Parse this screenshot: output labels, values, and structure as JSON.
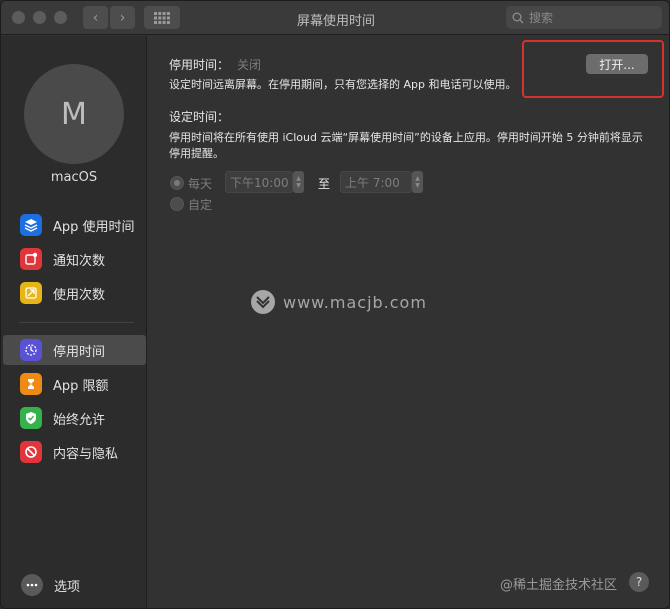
{
  "window": {
    "title": "屏幕使用时间"
  },
  "search": {
    "placeholder": "搜索"
  },
  "user": {
    "avatar_letter": "M",
    "name": "macOS"
  },
  "sidebar": {
    "items": [
      {
        "label": "App 使用时间",
        "icon": "layers-icon",
        "color": "#1b6fe0"
      },
      {
        "label": "通知次数",
        "icon": "notification-icon",
        "color": "#e0353a"
      },
      {
        "label": "使用次数",
        "icon": "pickup-icon",
        "color": "#e8b517"
      },
      {
        "label": "停用时间",
        "icon": "downtime-icon",
        "color": "#5a52d5",
        "active": true
      },
      {
        "label": "App 限额",
        "icon": "hourglass-icon",
        "color": "#ef8a17"
      },
      {
        "label": "始终允许",
        "icon": "checkmark-shield-icon",
        "color": "#35b24a"
      },
      {
        "label": "内容与隐私",
        "icon": "no-entry-icon",
        "color": "#e0353a"
      }
    ],
    "options_label": "选项"
  },
  "downtime": {
    "label": "停用时间：",
    "status": "关闭",
    "description": "设定时间远离屏幕。在停用期间，只有您选择的 App 和电话可以使用。",
    "open_button": "打开..."
  },
  "schedule": {
    "label": "设定时间：",
    "description_line1": "停用时间将在所有使用 iCloud 云端“屏幕使用时间”的设备上应用。停用时间开始 5 分钟前将显示",
    "description_line2": "停用提醒。",
    "option_everyday": "每天",
    "option_custom": "自定",
    "start_time": "下午10:00",
    "to_label": "至",
    "end_time": "上午  7:00"
  },
  "watermark": "www.macjb.com",
  "help_label": "?",
  "corner_watermark": "@稀土掘金技术社区",
  "colors": {
    "highlight": "#d4322c"
  }
}
